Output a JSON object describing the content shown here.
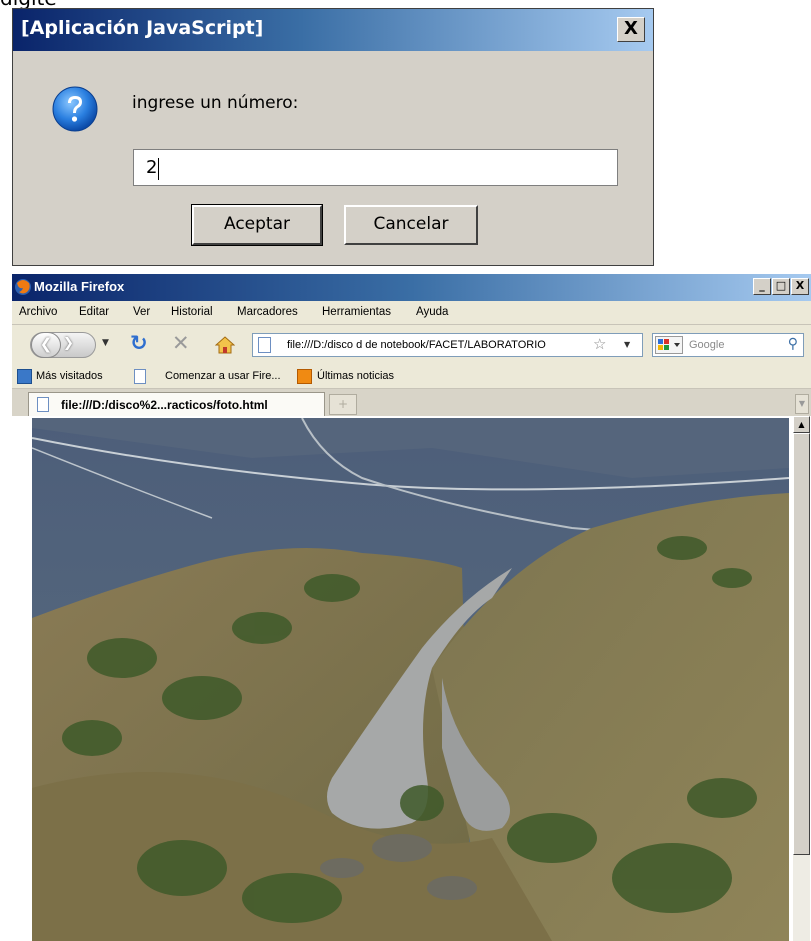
{
  "page_header_fragment": "digite",
  "dialog": {
    "title": "[Aplicación JavaScript]",
    "close_label": "X",
    "prompt": "ingrese un número:",
    "input_value": "2",
    "ok_label": "Aceptar",
    "cancel_label": "Cancelar",
    "icon": "question-icon"
  },
  "browser": {
    "title": "Mozilla Firefox",
    "window_controls": [
      "_",
      "□",
      "X"
    ],
    "menu": [
      "Archivo",
      "Editar",
      "Ver",
      "Historial",
      "Marcadores",
      "Herramientas",
      "Ayuda"
    ],
    "url": "file:///D:/disco d de notebook/FACET/LABORATORIO",
    "search_placeholder": "Google",
    "bookmarks": [
      "Más visitados",
      "Comenzar a usar Fire...",
      "Últimas noticias"
    ],
    "tab_title": "file:///D:/disco%2...racticos/foto.html",
    "new_tab_label": "+",
    "content": "photo of a winding mountain road"
  },
  "colors": {
    "titlebar_dark": "#0a246a",
    "titlebar_light": "#a6caf0",
    "dialog_bg": "#d4d0c8",
    "chrome_bg": "#ece9d8"
  }
}
